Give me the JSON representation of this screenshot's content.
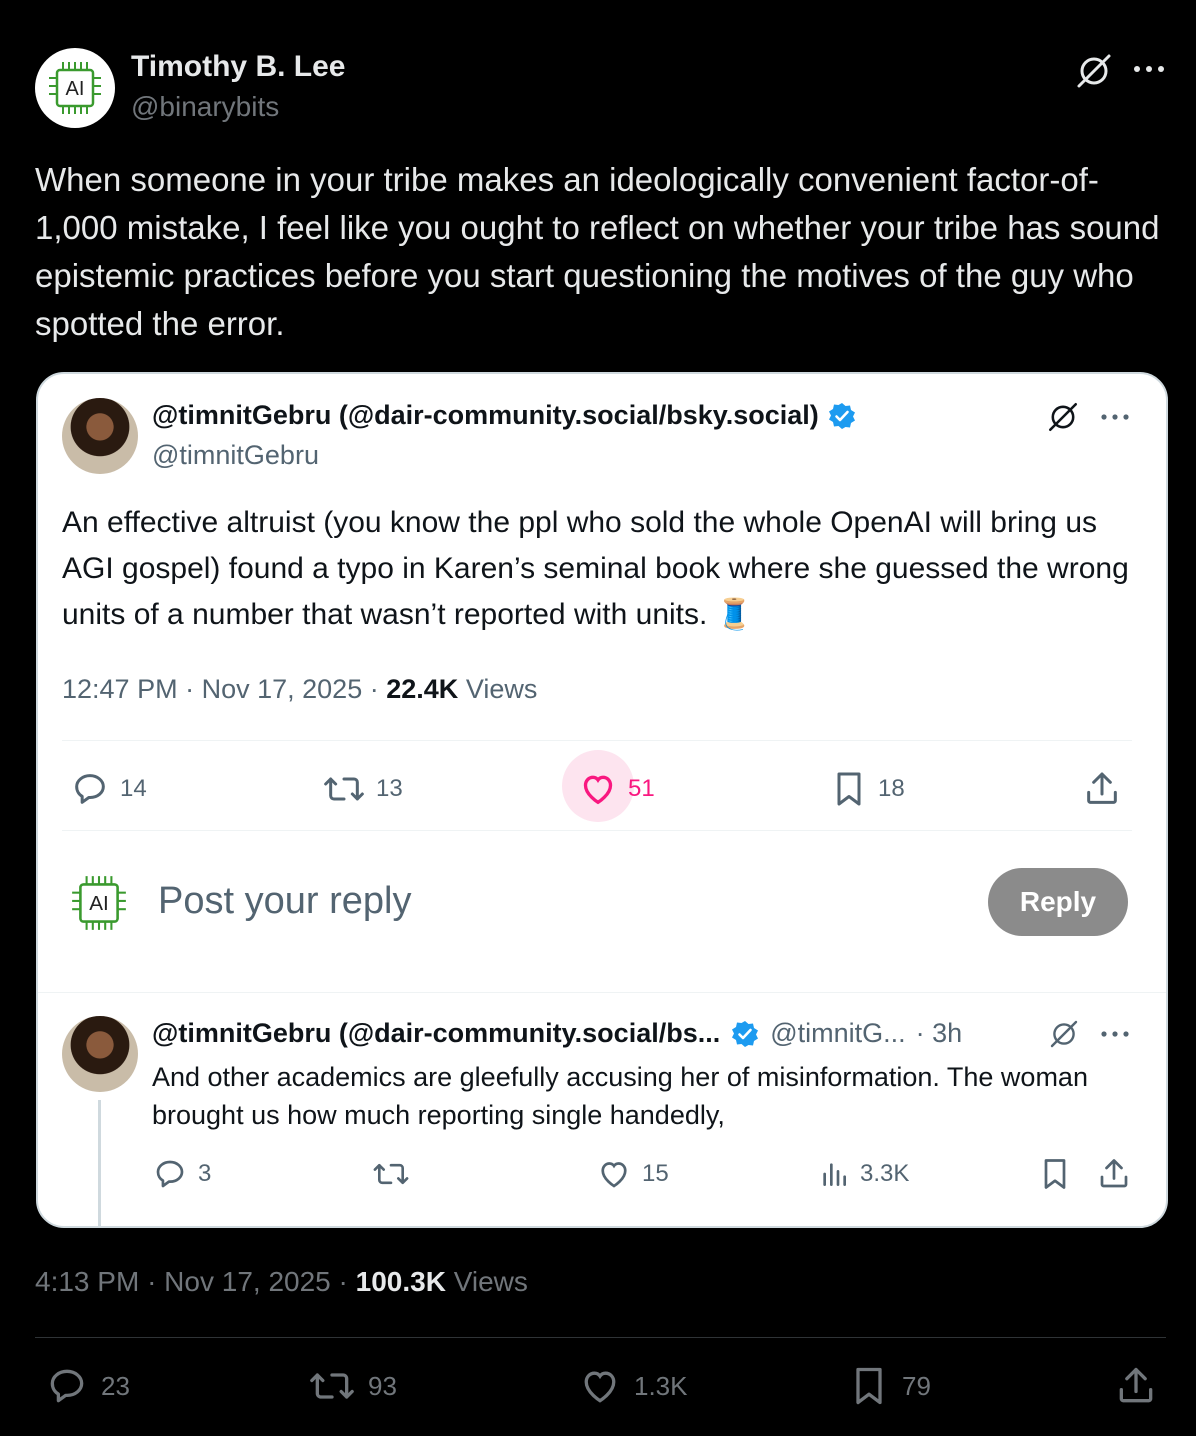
{
  "author": {
    "name": "Timothy B. Lee",
    "handle": "@binarybits",
    "avatar_text": "AI"
  },
  "tweet": {
    "text": "When someone in your tribe makes an ideologically convenient factor-of-1,000 mistake, I feel like you ought to reflect on whether your tribe has sound epistemic practices before you start questioning the motives of the guy who spotted the error.",
    "time": "4:13 PM",
    "date": "Nov 17, 2025",
    "views_count": "100.3K",
    "views_label": "Views",
    "replies": "23",
    "reposts": "93",
    "likes": "1.3K",
    "bookmarks": "79"
  },
  "quote": {
    "name": "@timnitGebru (@dair-community.social/bsky.social)",
    "handle": "@timnitGebru",
    "text": "An effective altruist (you know the ppl who sold the whole OpenAI will bring us AGI gospel) found a typo in Karen’s seminal book where she guessed the wrong units of a number that wasn’t reported with units.",
    "emoji": "🧵",
    "time": "12:47 PM",
    "date": "Nov 17, 2025",
    "views_count": "22.4K",
    "views_label": "Views",
    "replies": "14",
    "reposts": "13",
    "likes": "51",
    "bookmarks": "18"
  },
  "composer": {
    "avatar_text": "AI",
    "placeholder": "Post your reply",
    "button": "Reply"
  },
  "reply": {
    "name": "@timnitGebru (@dair-community.social/bs...",
    "handle": "@timnitG...",
    "age": "· 3h",
    "text": "And other academics are gleefully accusing her of misinformation. The woman brought us how much reporting single handedly,",
    "replies": "3",
    "likes": "15",
    "views": "3.3K"
  },
  "colors": {
    "background": "#000000",
    "card": "#ffffff",
    "verified": "#1d9bf0",
    "like_active": "#f91880",
    "reply_button": "#8b8b8b"
  }
}
